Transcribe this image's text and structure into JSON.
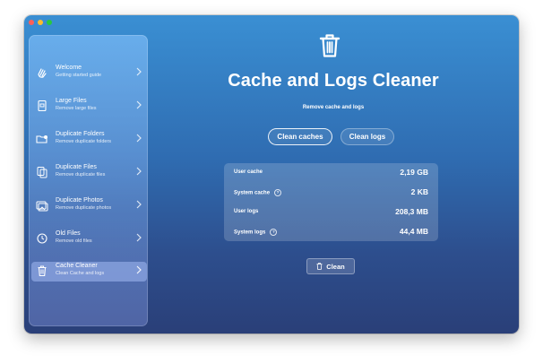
{
  "window": {
    "traffic_lights": [
      "close",
      "minimize",
      "zoom"
    ]
  },
  "sidebar": {
    "items": [
      {
        "title": "Welcome",
        "subtitle": "Getting started guide",
        "icon": "wave-hand-icon"
      },
      {
        "title": "Large Files",
        "subtitle": "Remove large files",
        "icon": "large-file-icon"
      },
      {
        "title": "Duplicate Folders",
        "subtitle": "Remove duplicate folders",
        "icon": "folder-duplicate-icon"
      },
      {
        "title": "Duplicate Files",
        "subtitle": "Remove duplicate files",
        "icon": "files-duplicate-icon"
      },
      {
        "title": "Duplicate Photos",
        "subtitle": "Remove duplicate photos",
        "icon": "photos-duplicate-icon"
      },
      {
        "title": "Old Files",
        "subtitle": "Remove old files",
        "icon": "clock-icon"
      },
      {
        "title": "Cache Cleaner",
        "subtitle": "Clean Cache and logs",
        "icon": "trash-icon",
        "active": true
      }
    ]
  },
  "main": {
    "icon": "trash-icon",
    "title": "Cache and Logs Cleaner",
    "subtitle": "Remove cache and logs",
    "tabs": [
      {
        "label": "Clean caches",
        "selected": true
      },
      {
        "label": "Clean logs",
        "selected": false
      }
    ],
    "stats": [
      {
        "label": "User cache",
        "value": "2,19 GB",
        "info": false
      },
      {
        "label": "System cache",
        "value": "2 KB",
        "info": true
      },
      {
        "label": "User logs",
        "value": "208,3 MB",
        "info": false
      },
      {
        "label": "System logs",
        "value": "44,4 MB",
        "info": true
      }
    ],
    "clean_button": "Clean"
  }
}
